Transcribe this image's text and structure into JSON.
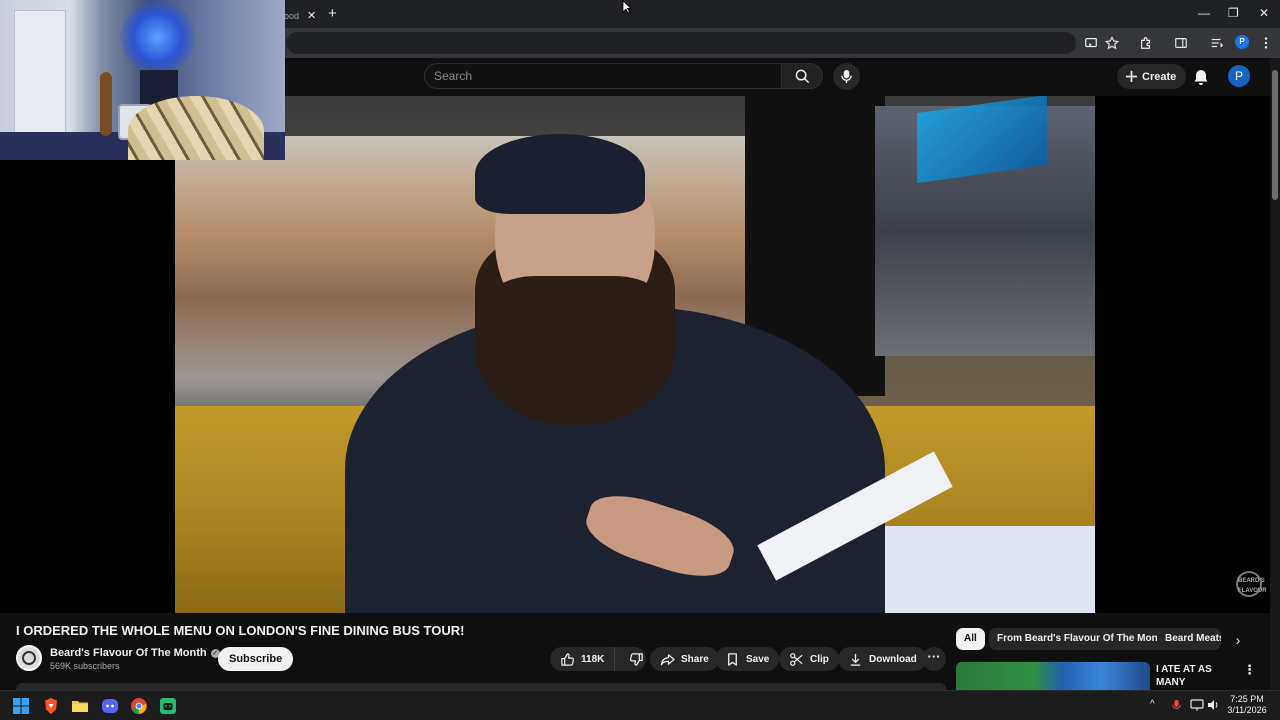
{
  "browser": {
    "tab_title": "ood",
    "tab_close": "✕",
    "new_tab": "+",
    "window": {
      "minimize": "—",
      "restore": "❐",
      "close": "✕"
    },
    "profile_initial": "P"
  },
  "masthead": {
    "search_placeholder": "Search",
    "create_label": "Create",
    "avatar_initial": "P"
  },
  "video": {
    "title": "I ORDERED THE WHOLE MENU ON LONDON'S FINE DINING BUS TOUR!",
    "watermark": "BEARD'S FLAVOUR"
  },
  "channel": {
    "name": "Beard's Flavour Of The Month",
    "verified": "✓",
    "subscribers": "569K subscribers",
    "subscribe_label": "Subscribe"
  },
  "actions": {
    "likes": "118K",
    "share": "Share",
    "save": "Save",
    "clip": "Clip",
    "download": "Download",
    "more": "···"
  },
  "sidebar": {
    "chips": [
      "All",
      "From Beard's Flavour Of The Month",
      "Beard Meats"
    ],
    "next": "›",
    "related": [
      {
        "title": "I ATE AT AS MANY CHRISTMAS ...",
        "more": "⋮"
      }
    ]
  },
  "taskbar": {
    "time": "7:25 PM",
    "date": "3/11/2026",
    "tray_chevron": "^"
  },
  "colors": {
    "background": "#0f0f0f",
    "pill": "#272727",
    "accent_blue": "#1565c0"
  }
}
